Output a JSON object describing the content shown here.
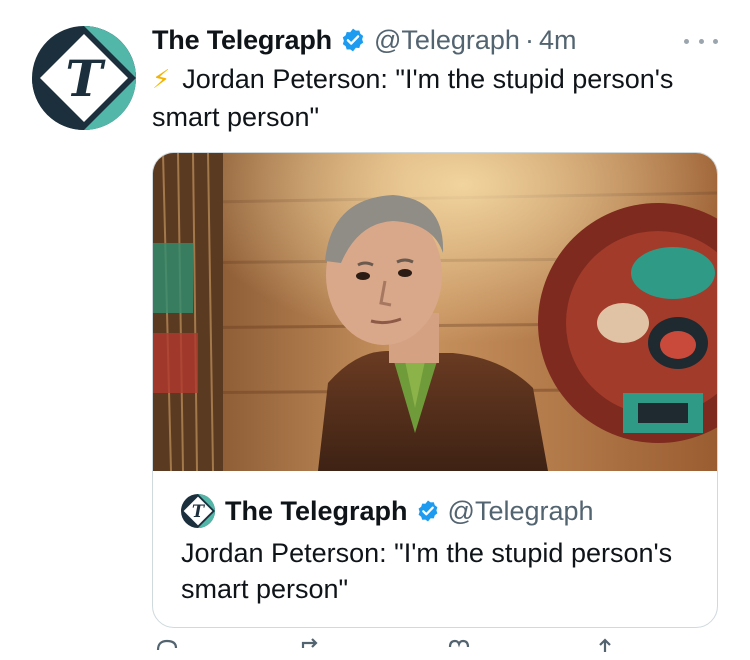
{
  "tweet": {
    "author": {
      "display_name": "The Telegraph",
      "handle": "@Telegraph",
      "verified": true,
      "avatar_icon": "telegraph-t-logo-icon",
      "avatar_colors": [
        "#1c2f3d",
        "#52b7a8",
        "#ffffff"
      ]
    },
    "separator": "·",
    "time": "4m",
    "more_icon": "more-horizontal-icon",
    "emoji": "⚡",
    "text": "Jordan Peterson: \"I'm the stupid person's smart person\""
  },
  "quoted_card": {
    "image_alt": "Jordan Peterson in a brown tweed jacket in front of a wooden wall with totem carvings",
    "author": {
      "display_name": "The Telegraph",
      "handle": "@Telegraph",
      "verified": true
    },
    "text": "Jordan Peterson: \"I'm the stupid person's smart person\""
  },
  "actions": [
    {
      "icon": "reply-icon"
    },
    {
      "icon": "retweet-icon"
    },
    {
      "icon": "like-icon"
    },
    {
      "icon": "share-icon"
    }
  ],
  "colors": {
    "verified_blue": "#1d9bf0",
    "muted_text": "#536471",
    "card_border": "#cfd9de",
    "bolt": "#f4b400"
  }
}
